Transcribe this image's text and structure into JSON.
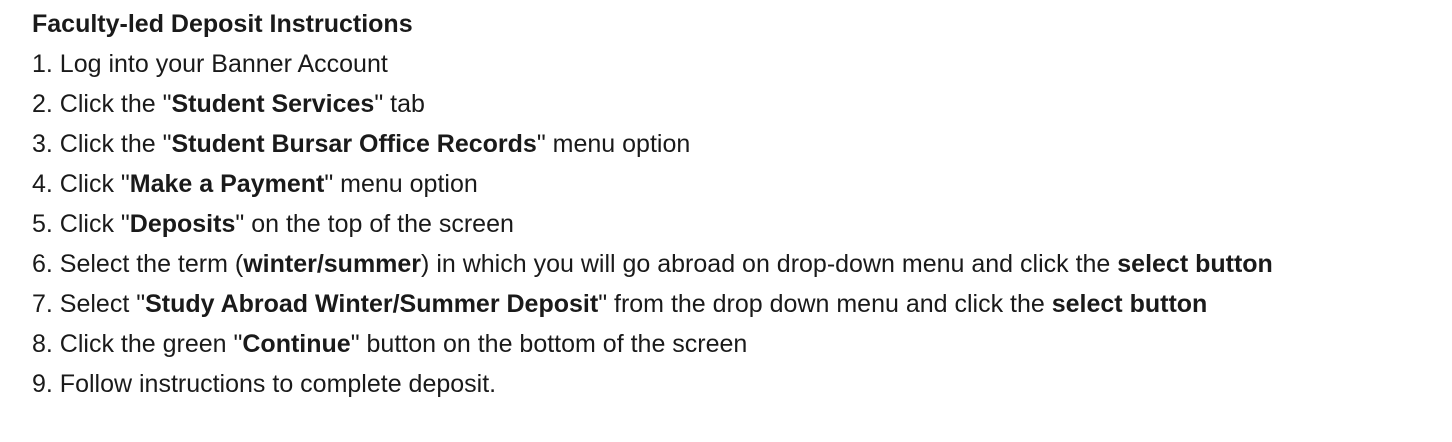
{
  "document": {
    "heading": "Faculty-led Deposit Instructions",
    "steps": [
      [
        {
          "t": "1. Log into your Banner Account"
        }
      ],
      [
        {
          "t": "2. Click the \""
        },
        {
          "t": "Student Services",
          "b": true
        },
        {
          "t": "\" tab"
        }
      ],
      [
        {
          "t": "3. Click the \""
        },
        {
          "t": "Student Bursar Office Records",
          "b": true
        },
        {
          "t": "\" menu option"
        }
      ],
      [
        {
          "t": "4. Click \""
        },
        {
          "t": "Make a Payment",
          "b": true
        },
        {
          "t": "\" menu option"
        }
      ],
      [
        {
          "t": "5. Click \""
        },
        {
          "t": "Deposits",
          "b": true
        },
        {
          "t": "\" on the top of the screen"
        }
      ],
      [
        {
          "t": "6. Select the term ("
        },
        {
          "t": "winter/summer",
          "b": true
        },
        {
          "t": ") in which you will go abroad on drop-down menu and click the "
        },
        {
          "t": "select button",
          "b": true
        }
      ],
      [
        {
          "t": "7. Select \""
        },
        {
          "t": "Study Abroad Winter/Summer Deposit",
          "b": true
        },
        {
          "t": "\" from the drop down menu and click the "
        },
        {
          "t": "select button",
          "b": true
        }
      ],
      [
        {
          "t": "8. Click the green \""
        },
        {
          "t": "Continue",
          "b": true
        },
        {
          "t": "\" button on the bottom of the screen"
        }
      ],
      [
        {
          "t": "9. Follow instructions to complete deposit."
        }
      ]
    ]
  }
}
